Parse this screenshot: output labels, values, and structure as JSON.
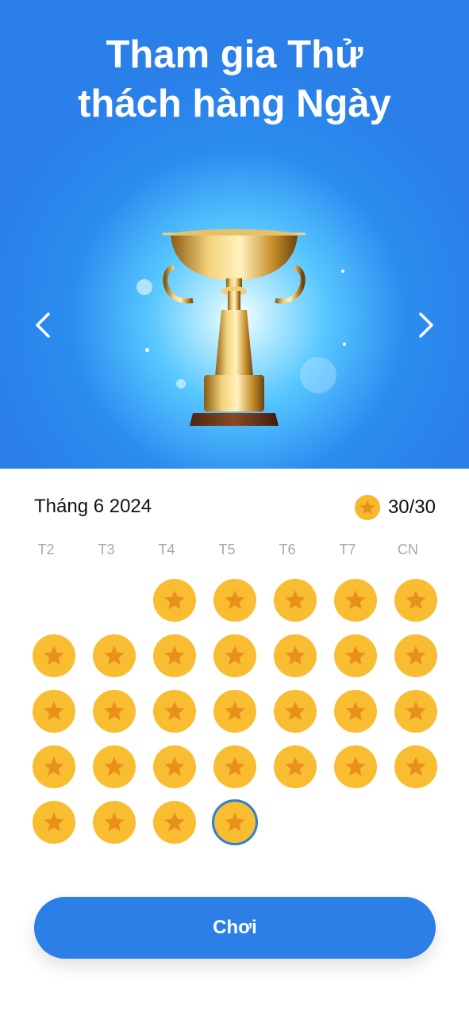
{
  "hero": {
    "title_line1": "Tham gia Thử",
    "title_line2": "thách hàng Ngày"
  },
  "calendar": {
    "month": "Tháng 6 2024",
    "score": "30/30",
    "weekdays": [
      "T2",
      "T3",
      "T4",
      "T5",
      "T6",
      "T7",
      "CN"
    ],
    "completed_days": 30,
    "today_day": 30
  },
  "play_button": {
    "label": "Chơi"
  },
  "colors": {
    "primary": "#2B7FE6",
    "coin": "#F8BD30",
    "star": "#E9901A",
    "today_ring": "#2F7FD6"
  },
  "icons": {
    "left": "chevron-left-icon",
    "right": "chevron-right-icon",
    "coin": "star-coin-icon",
    "trophy": "trophy-icon"
  }
}
